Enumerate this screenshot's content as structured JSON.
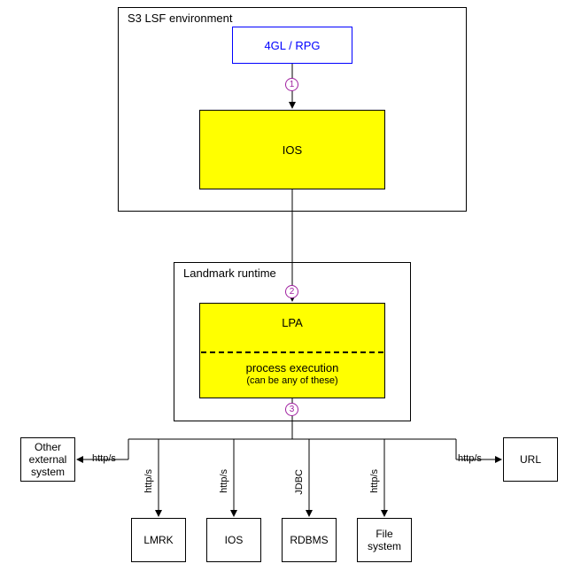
{
  "containers": {
    "s3": {
      "title": "S3 LSF environment"
    },
    "landmark": {
      "title": "Landmark runtime"
    }
  },
  "boxes": {
    "rpg": "4GL / RPG",
    "ios_top": "IOS",
    "lpa": "LPA",
    "lpa_sub1": "process execution",
    "lpa_sub2": "(can be any of these)",
    "other": "Other external system",
    "lmrk": "LMRK",
    "ios_bottom": "IOS",
    "rdbms": "RDBMS",
    "file": "File system",
    "url": "URL"
  },
  "steps": {
    "s1": "1",
    "s2": "2",
    "s3": "3"
  },
  "protocols": {
    "http": "http/s",
    "jdbc": "JDBC"
  }
}
